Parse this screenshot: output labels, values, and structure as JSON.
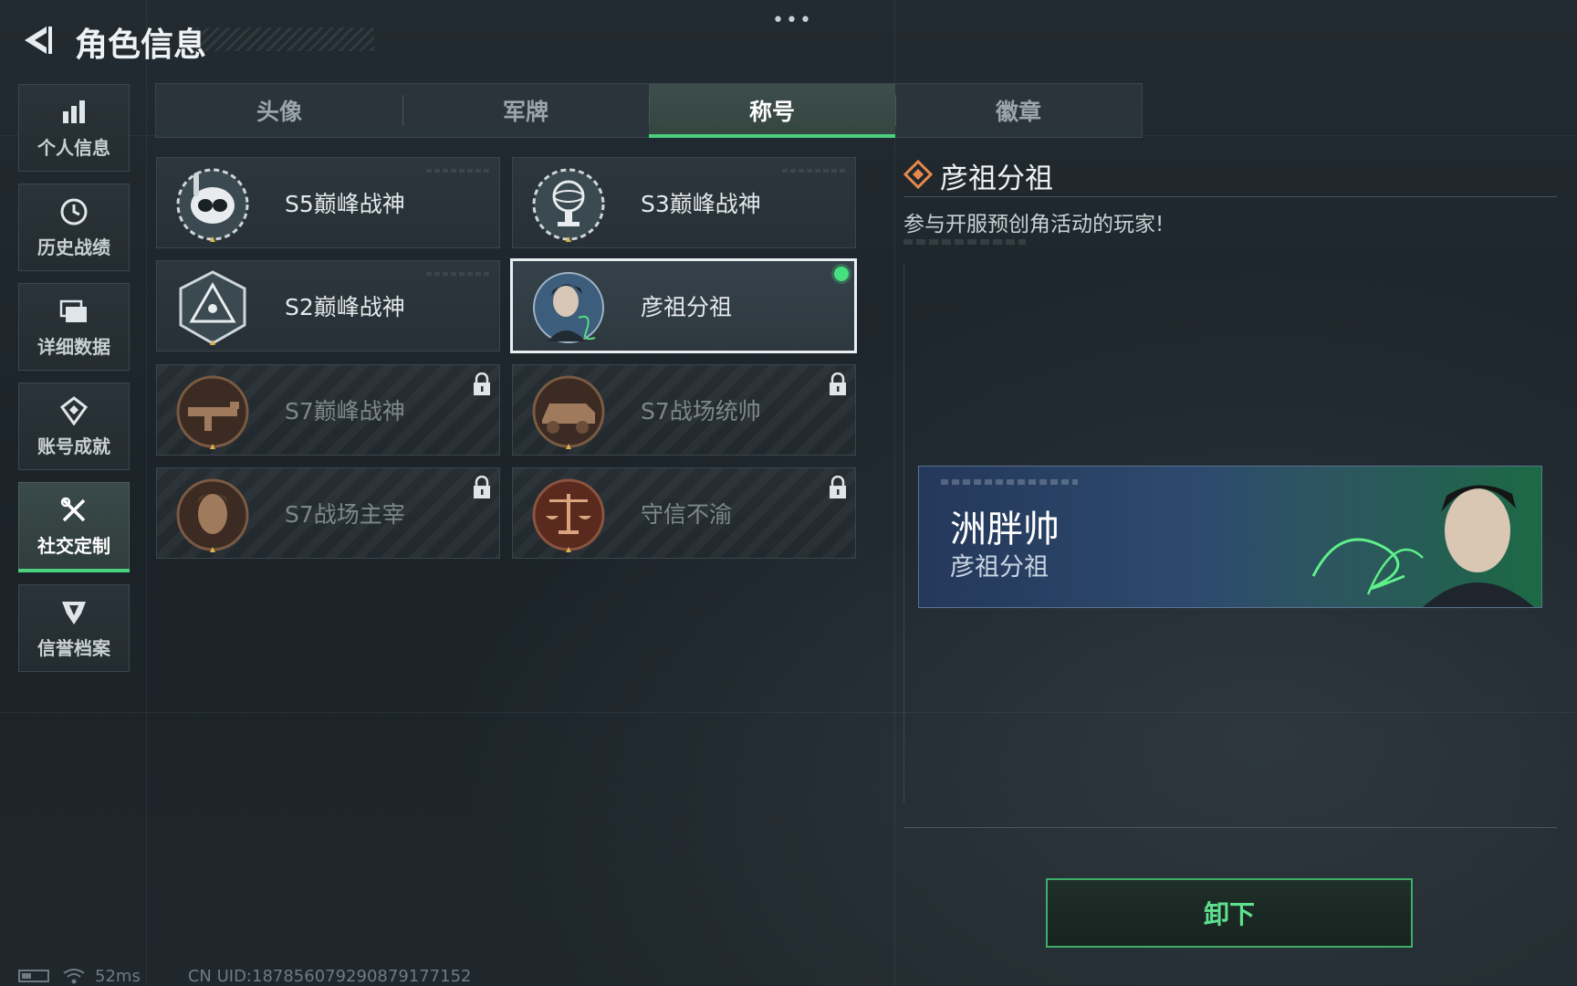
{
  "header": {
    "title": "角色信息",
    "more_menu": "•••"
  },
  "sidebar": {
    "items": [
      {
        "label": "个人信息",
        "icon": "bar-chart-icon"
      },
      {
        "label": "历史战绩",
        "icon": "clock-icon"
      },
      {
        "label": "详细数据",
        "icon": "folders-icon"
      },
      {
        "label": "账号成就",
        "icon": "medal-icon"
      },
      {
        "label": "社交定制",
        "icon": "tools-icon",
        "active": true
      },
      {
        "label": "信誉档案",
        "icon": "shield-icon"
      }
    ]
  },
  "tabs": [
    {
      "label": "头像"
    },
    {
      "label": "军牌"
    },
    {
      "label": "称号",
      "active": true
    },
    {
      "label": "徽章"
    }
  ],
  "titles": [
    {
      "label": "S5巅峰战神",
      "icon": "diver-skull-emblem-icon",
      "locked": false
    },
    {
      "label": "S3巅峰战神",
      "icon": "globe-trophy-emblem-icon",
      "locked": false
    },
    {
      "label": "S2巅峰战神",
      "icon": "triangle-eye-emblem-icon",
      "locked": false
    },
    {
      "label": "彦祖分祖",
      "icon": "portrait-emblem-icon",
      "locked": false,
      "selected": true,
      "equipped": true
    },
    {
      "label": "S7巅峰战神",
      "icon": "rifle-emblem-icon",
      "locked": true
    },
    {
      "label": "S7战场统帅",
      "icon": "armored-vehicle-emblem-icon",
      "locked": true
    },
    {
      "label": "S7战场主宰",
      "icon": "warrior-face-emblem-icon",
      "locked": true
    },
    {
      "label": "守信不渝",
      "icon": "scales-emblem-icon",
      "locked": true
    }
  ],
  "detail": {
    "title": "彦祖分祖",
    "description": "参与开服预创角活动的玩家!"
  },
  "preview": {
    "player_name": "洲胖帅",
    "title": "彦祖分祖"
  },
  "actions": {
    "unequip_label": "卸下"
  },
  "status": {
    "ping": "52ms",
    "uid": "CN UID:1878560792908791771‍52"
  },
  "colors": {
    "accent_green": "#4ad07c",
    "background": "#1d252b",
    "detail_icon": "#e8894a"
  }
}
